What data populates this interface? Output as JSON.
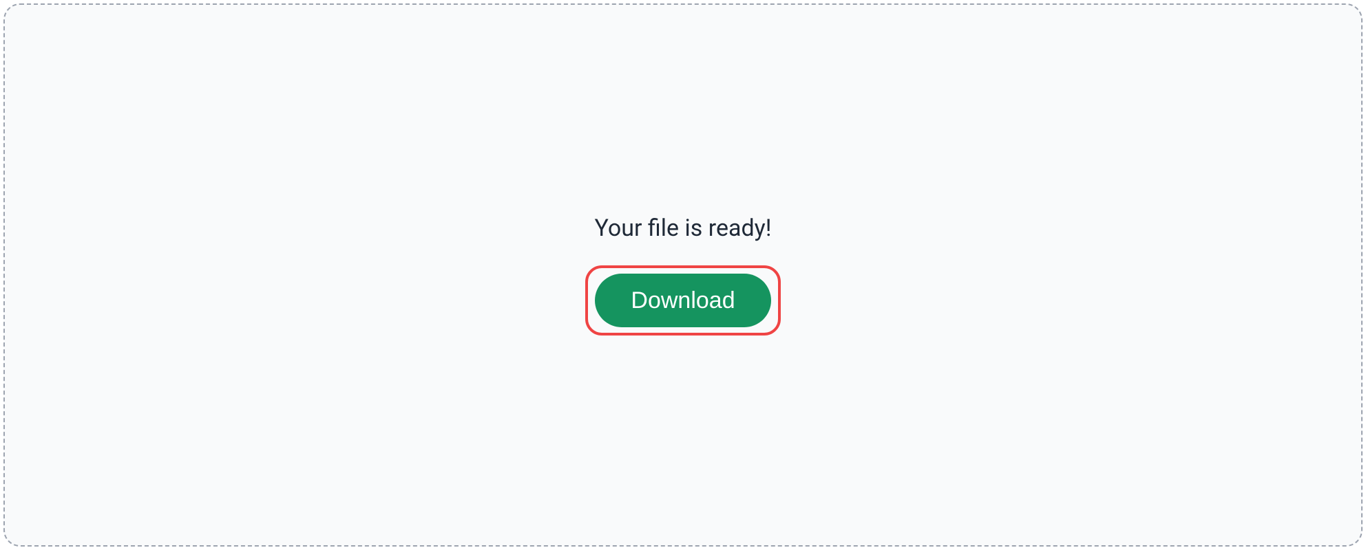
{
  "main": {
    "message": "Your file is ready!",
    "download_label": "Download"
  }
}
